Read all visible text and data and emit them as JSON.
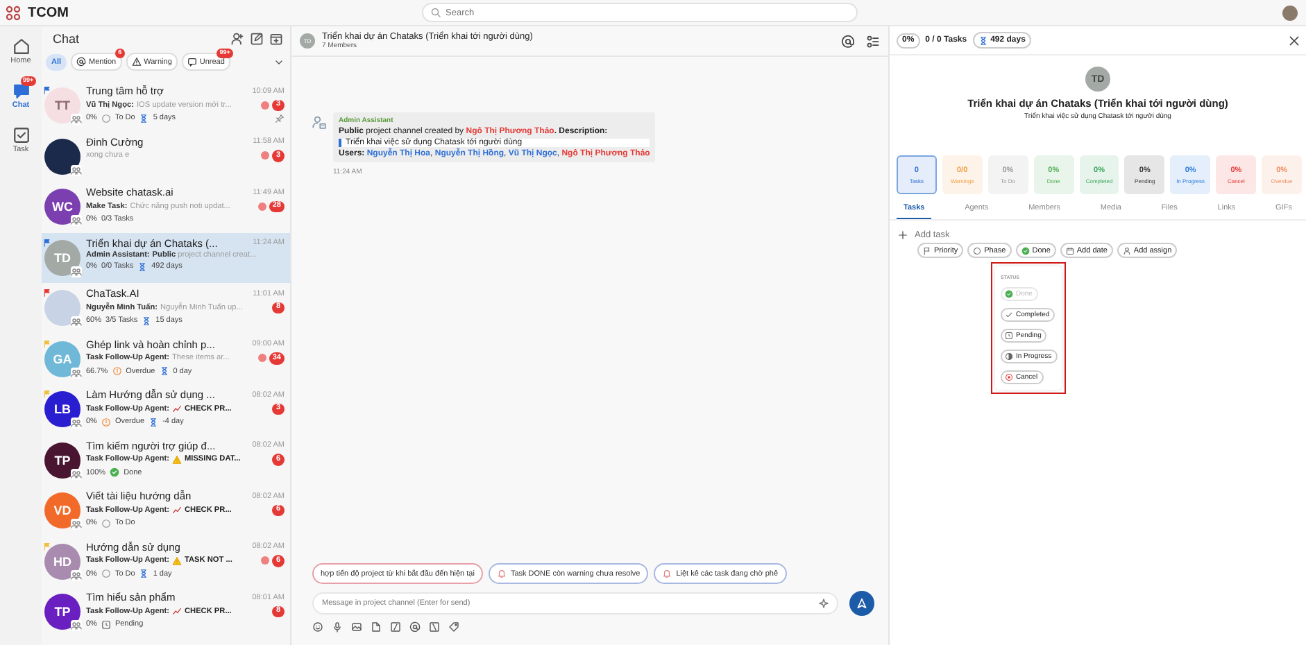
{
  "app": {
    "name": "TCOM",
    "search_placeholder": "Search"
  },
  "rail": [
    {
      "label": "Home",
      "kind": "home",
      "selected": false
    },
    {
      "label": "Chat",
      "kind": "chat",
      "selected": true,
      "badge": "99+"
    },
    {
      "label": "Task",
      "kind": "task",
      "selected": false
    }
  ],
  "chat_list": {
    "title": "Chat",
    "filters": [
      {
        "label": "All",
        "kind": "plain",
        "selected": true
      },
      {
        "label": "Mention",
        "kind": "mention",
        "selected": false,
        "badge": "6"
      },
      {
        "label": "Warning",
        "kind": "warning",
        "selected": false
      },
      {
        "label": "Unread",
        "kind": "unread",
        "selected": false,
        "badge": "99+"
      }
    ],
    "items": [
      {
        "initials": "TT",
        "color": "#f6dfe3",
        "flag": {
          "color": "#2d6fd6"
        },
        "title": "Trung tâm hỗ trợ",
        "time": "10:09 AM",
        "sender": "Vũ Thị Ngọc:",
        "preview": {
          "kind": "plain",
          "text": "IOS update version mới tr..."
        },
        "mention_dot": true,
        "count": "3",
        "progress": "0%",
        "status": {
          "kind": "todo",
          "label": "To Do"
        },
        "days": "5 days",
        "pinned": true,
        "selected": false
      },
      {
        "color": "#1b2a4a",
        "title": "Đinh Cường",
        "time": "11:58 AM",
        "preview": {
          "kind": "plain",
          "text": "xong chưa e"
        },
        "mention_dot": true,
        "count": "3",
        "pinned": false,
        "selected": false
      },
      {
        "initials": "WC",
        "color": "#7b3fb0",
        "title": "Website chatask.ai",
        "time": "11:49 AM",
        "sender": "Make Task:",
        "preview": {
          "kind": "plain",
          "text": "Chức năng push noti updat..."
        },
        "mention_dot": true,
        "count": "28",
        "progress": "0%",
        "tasks": "0/3 Tasks",
        "pinned": false,
        "selected": false
      },
      {
        "initials": "TD",
        "color": "#a3aaa6",
        "flag": {
          "color": "#2d6fd6"
        },
        "title": "Triển khai dự án Chataks (...",
        "time": "11:24 AM",
        "sender": "Admin Assistant:",
        "preview": {
          "kind": "plain",
          "text": "**Public** project channel creat..."
        },
        "mention_dot": false,
        "progress": "0%",
        "tasks": "0/0 Tasks",
        "days": "492 days",
        "pinned": false,
        "selected": true
      },
      {
        "color": "#c9d3e6",
        "flag": {
          "color": "#e53935"
        },
        "title": "ChaTask.AI",
        "time": "11:01 AM",
        "sender": "Nguyễn Minh Tuấn:",
        "preview": {
          "kind": "plain",
          "text": "Nguyễn Minh Tuấn up..."
        },
        "mention_dot": false,
        "count": "8",
        "progress": "60%",
        "tasks": "3/5 Tasks",
        "days": "15 days",
        "pinned": false,
        "selected": false
      },
      {
        "initials": "GA",
        "color": "#6fb8d8",
        "flag": {
          "color": "#f0c040"
        },
        "title": "Ghép link và hoàn chỉnh p...",
        "time": "09:00 AM",
        "sender": "Task Follow-Up Agent:",
        "preview": {
          "kind": "plain",
          "text": "These items ar..."
        },
        "mention_dot": true,
        "count": "34",
        "progress": "66.7%",
        "status": {
          "kind": "overdue",
          "label": "Overdue"
        },
        "days": "0 day",
        "pinned": false,
        "selected": false
      },
      {
        "initials": "LB",
        "color": "#2a1fd0",
        "flag": {
          "color": "#f0c040"
        },
        "title": "Làm Hướng dẫn sử dụng ...",
        "time": "08:02 AM",
        "sender": "Task Follow-Up Agent:",
        "preview": {
          "kind": "chart",
          "text": "CHECK PR..."
        },
        "mention_dot": false,
        "count": "3",
        "progress": "0%",
        "status": {
          "kind": "overdue",
          "label": "Overdue"
        },
        "days": "-4 day",
        "pinned": false,
        "selected": false
      },
      {
        "initials": "TP",
        "color": "#4a1530",
        "title": "Tìm kiếm người trợ giúp đ...",
        "time": "08:02 AM",
        "sender": "Task Follow-Up Agent:",
        "preview": {
          "kind": "warning",
          "text": "MISSING DAT..."
        },
        "mention_dot": false,
        "count": "6",
        "progress": "100%",
        "status": {
          "kind": "done",
          "label": "Done"
        },
        "pinned": false,
        "selected": false
      },
      {
        "initials": "VD",
        "color": "#f26a2a",
        "title": "Viết tài liệu hướng dẫn",
        "time": "08:02 AM",
        "sender": "Task Follow-Up Agent:",
        "preview": {
          "kind": "chart",
          "text": "CHECK PR..."
        },
        "mention_dot": false,
        "count": "6",
        "progress": "0%",
        "status": {
          "kind": "todo",
          "label": "To Do"
        },
        "pinned": false,
        "selected": false
      },
      {
        "initials": "HD",
        "color": "#a98bb0",
        "flag": {
          "color": "#f0c040"
        },
        "title": "Hướng dẫn sử dụng",
        "time": "08:02 AM",
        "sender": "Task Follow-Up Agent:",
        "preview": {
          "kind": "warning",
          "text": "TASK NOT ..."
        },
        "mention_dot": true,
        "count": "6",
        "progress": "0%",
        "status": {
          "kind": "todo",
          "label": "To Do"
        },
        "days": "1 day",
        "pinned": false,
        "selected": false
      },
      {
        "initials": "TP",
        "color": "#6a1fc0",
        "title": "Tìm hiểu sản phẩm",
        "time": "08:01 AM",
        "sender": "Task Follow-Up Agent:",
        "preview": {
          "kind": "chart",
          "text": "CHECK PR..."
        },
        "mention_dot": false,
        "count": "8",
        "progress": "0%",
        "status": {
          "kind": "pending",
          "label": "Pending"
        },
        "pinned": false,
        "selected": false
      }
    ]
  },
  "conversation": {
    "initials": "TD",
    "title": "Triển khai dự án Chataks (Triển khai tới người dùng)",
    "members": "7 Members",
    "messages": [
      {
        "sender": "Admin Assistant",
        "time": "11:24 AM",
        "lines": [
          {
            "kind": "text",
            "segments": [
              {
                "kind": "bold",
                "text": "Public"
              },
              {
                "kind": "plain",
                "text": " project channel created by "
              },
              {
                "kind": "owner",
                "text": "Ngô Thị Phương Thảo"
              },
              {
                "kind": "bold",
                "text": ". Description:"
              }
            ]
          },
          {
            "kind": "quote",
            "segments": [
              {
                "kind": "plain",
                "text": "Triển khai việc sử dụng Chatask tới người dùng"
              }
            ]
          },
          {
            "kind": "text",
            "segments": [
              {
                "kind": "bold",
                "text": "Users: "
              },
              {
                "kind": "user",
                "text": "Nguyễn Thị Hoa"
              },
              {
                "kind": "plain",
                "text": ", "
              },
              {
                "kind": "user",
                "text": "Nguyễn Thị Hồng"
              },
              {
                "kind": "plain",
                "text": ", "
              },
              {
                "kind": "user",
                "text": "Vũ Thị Ngọc"
              },
              {
                "kind": "plain",
                "text": ", "
              },
              {
                "kind": "owner",
                "text": "Ngô Thị Phương Thảo"
              }
            ]
          }
        ]
      }
    ],
    "suggestions": [
      "hợp tiến độ project từ khi bắt đầu đến hiện tại",
      "Task DONE còn warning chưa resolve",
      "Liệt kê các task đang chờ phê"
    ],
    "input_placeholder": "Message in project channel (Enter for send)"
  },
  "details": {
    "progress": "0%",
    "tasks": "0 / 0 Tasks",
    "days": "492 days",
    "initials": "TD",
    "title": "Triển khai dự án Chataks (Triển khai tới người dùng)",
    "subtitle": "Triển khai việc sử dụng Chatask tới người dùng",
    "stats": [
      {
        "value": "0",
        "label": "Tasks",
        "color": "#2d6fd6",
        "selected": true
      },
      {
        "value": "0/0",
        "label": "Warnings",
        "color": "#f0a040",
        "selected": false
      },
      {
        "value": "0%",
        "label": "To Do",
        "color": "#9a9a9a",
        "selected": false
      },
      {
        "value": "0%",
        "label": "Done",
        "color": "#4caf50",
        "selected": false
      },
      {
        "value": "0%",
        "label": "Completed",
        "color": "#3ba55c",
        "selected": false
      },
      {
        "value": "0%",
        "label": "Pending",
        "color": "#333333",
        "selected": false
      },
      {
        "value": "0%",
        "label": "In Progress",
        "color": "#2d7be0",
        "selected": false
      },
      {
        "value": "0%",
        "label": "Cancel",
        "color": "#e53935",
        "selected": false
      },
      {
        "value": "0%",
        "label": "Overdue",
        "color": "#f08a5d",
        "selected": false
      }
    ],
    "tabs": [
      {
        "label": "Tasks",
        "selected": true
      },
      {
        "label": "Agents",
        "selected": false
      },
      {
        "label": "Members",
        "selected": false
      },
      {
        "label": "Media",
        "selected": false
      },
      {
        "label": "Files",
        "selected": false
      },
      {
        "label": "Links",
        "selected": false
      },
      {
        "label": "GIFs",
        "selected": false
      }
    ],
    "add_task_placeholder": "Add task",
    "task_chips": [
      {
        "label": "Priority",
        "kind": "priority"
      },
      {
        "label": "Phase",
        "kind": "phase"
      },
      {
        "label": "Done",
        "kind": "done"
      },
      {
        "label": "Add date",
        "kind": "date"
      },
      {
        "label": "Add assign",
        "kind": "assign"
      }
    ],
    "status_menu": {
      "title": "STATUS",
      "highlighted": true,
      "options": [
        {
          "label": "Done",
          "kind": "done",
          "selected": true
        },
        {
          "label": "Completed",
          "kind": "completed",
          "selected": false
        },
        {
          "label": "Pending",
          "kind": "pending",
          "selected": false
        },
        {
          "label": "In Progress",
          "kind": "in_progress",
          "selected": false
        },
        {
          "label": "Cancel",
          "kind": "cancel",
          "selected": false
        }
      ]
    }
  }
}
